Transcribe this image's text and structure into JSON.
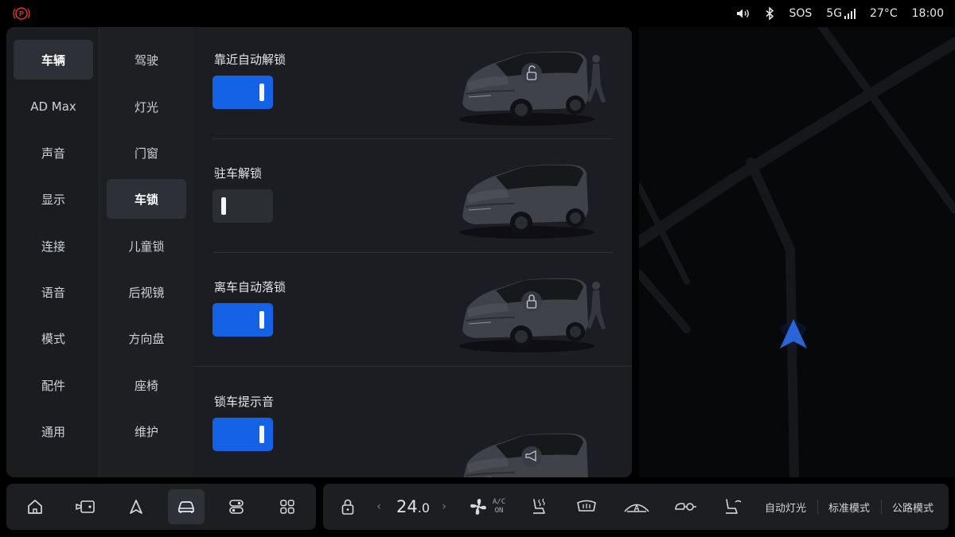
{
  "status": {
    "volume_icon": "speaker-icon",
    "bluetooth_icon": "bluetooth-icon",
    "sos": "SOS",
    "network": "5G",
    "temperature": "27°C",
    "time": "18:00",
    "park_color": "#d8332e"
  },
  "nav_primary": [
    {
      "label": "车辆",
      "active": true
    },
    {
      "label": "AD Max",
      "active": false
    },
    {
      "label": "声音",
      "active": false
    },
    {
      "label": "显示",
      "active": false
    },
    {
      "label": "连接",
      "active": false
    },
    {
      "label": "语音",
      "active": false
    },
    {
      "label": "模式",
      "active": false
    },
    {
      "label": "配件",
      "active": false
    },
    {
      "label": "通用",
      "active": false
    }
  ],
  "nav_secondary": [
    {
      "label": "驾驶",
      "active": false
    },
    {
      "label": "灯光",
      "active": false
    },
    {
      "label": "门窗",
      "active": false
    },
    {
      "label": "车锁",
      "active": true
    },
    {
      "label": "儿童锁",
      "active": false
    },
    {
      "label": "后视镜",
      "active": false
    },
    {
      "label": "方向盘",
      "active": false
    },
    {
      "label": "座椅",
      "active": false
    },
    {
      "label": "维护",
      "active": false
    }
  ],
  "settings": [
    {
      "title": "靠近自动解锁",
      "enabled": true,
      "badge": "unlock-icon",
      "person": true
    },
    {
      "title": "驻车解锁",
      "enabled": false,
      "badge": "",
      "person": false
    },
    {
      "title": "离车自动落锁",
      "enabled": true,
      "badge": "lock-icon",
      "person": true
    },
    {
      "title": "锁车提示音",
      "enabled": true,
      "badge": "horn-icon",
      "person": false
    }
  ],
  "dock": {
    "apps": [
      "home-icon",
      "media-icon",
      "navigation-icon",
      "vehicle-icon",
      "controls-icon",
      "apps-grid-icon"
    ],
    "active_index": 3
  },
  "climate": {
    "temperature_int": "24",
    "temperature_dec": ".0",
    "ac_line1": "A/C",
    "ac_line2": "ON",
    "modes": [
      "自动灯光",
      "标准模式",
      "公路模式"
    ]
  },
  "colors": {
    "accent": "#1463e6",
    "nav_arrow": "#2a64d6"
  }
}
